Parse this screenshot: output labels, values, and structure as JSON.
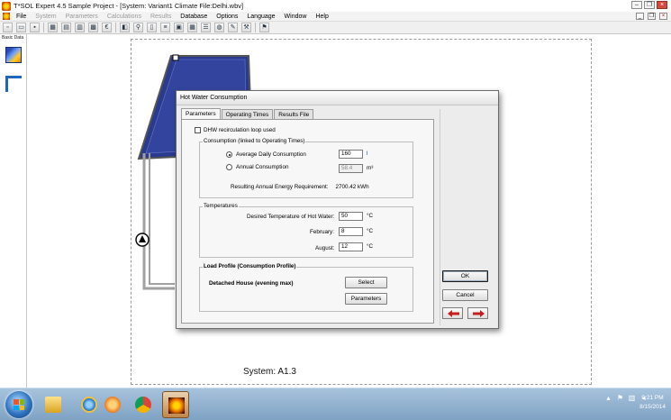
{
  "window": {
    "title": "T*SOL Expert 4.5 Sample Project - [System: Variant1   Climate File:Delhi.wbv]"
  },
  "menu": {
    "items": [
      {
        "label": "File",
        "enabled": true
      },
      {
        "label": "System",
        "enabled": false
      },
      {
        "label": "Parameters",
        "enabled": false
      },
      {
        "label": "Calculations",
        "enabled": false
      },
      {
        "label": "Results",
        "enabled": false
      },
      {
        "label": "Database",
        "enabled": true
      },
      {
        "label": "Options",
        "enabled": true
      },
      {
        "label": "Language",
        "enabled": true
      },
      {
        "label": "Window",
        "enabled": true
      },
      {
        "label": "Help",
        "enabled": true
      }
    ]
  },
  "toolbar": {
    "icons": [
      "new-file-icon",
      "open-folder-icon",
      "save-icon",
      "chart-icon",
      "table-icon",
      "report-icon",
      "calc-icon",
      "euro-icon",
      "preview-icon",
      "zoom-icon",
      "document-icon",
      "text-icon",
      "image-icon",
      "grid-icon",
      "list-icon",
      "globe-icon",
      "edit-icon",
      "tools-icon",
      "flag-icon"
    ]
  },
  "left_panel": {
    "label": "Basic Data"
  },
  "canvas": {
    "system_label": "System: A1.3"
  },
  "dialog": {
    "title": "Hot Water Consumption",
    "tabs": [
      {
        "label": "Parameters",
        "active": true
      },
      {
        "label": "Operating Times",
        "active": false
      },
      {
        "label": "Results File",
        "active": false
      }
    ],
    "recirculation": {
      "label": "DHW recirculation loop used",
      "checked": false
    },
    "consumption": {
      "group_title": "Consumption (linked to Operating Times)",
      "daily_label": "Average Daily Consumption",
      "daily_value": "160",
      "daily_unit": "l",
      "daily_selected": true,
      "annual_label": "Annual Consumption",
      "annual_value": "58.4",
      "annual_unit": "m³",
      "annual_selected": false,
      "energy_label": "Resulting Annual Energy Requirement:",
      "energy_value": "2700.42 kWh"
    },
    "temperatures": {
      "group_title": "Temperatures",
      "desired_label": "Desired Temperature of Hot Water:",
      "desired_value": "50",
      "february_label": "February:",
      "february_value": "8",
      "august_label": "August:",
      "august_value": "12",
      "unit": "°C"
    },
    "load_profile": {
      "group_title": "Load Profile (Consumption Profile)",
      "profile_name": "Detached House (evening max)",
      "select_label": "Select",
      "parameters_label": "Parameters"
    },
    "buttons": {
      "ok": "OK",
      "cancel": "Cancel"
    }
  },
  "taskbar": {
    "time": "9:21 PM",
    "date": "8/15/2014",
    "apps": [
      "explorer-icon",
      "ie-icon",
      "media-player-icon",
      "chrome-icon",
      "tsol-icon"
    ]
  },
  "colors": {
    "accent_red": "#c41e1e",
    "taskbar": "#7fa2c3",
    "collector_blue": "#2a3a8f"
  }
}
